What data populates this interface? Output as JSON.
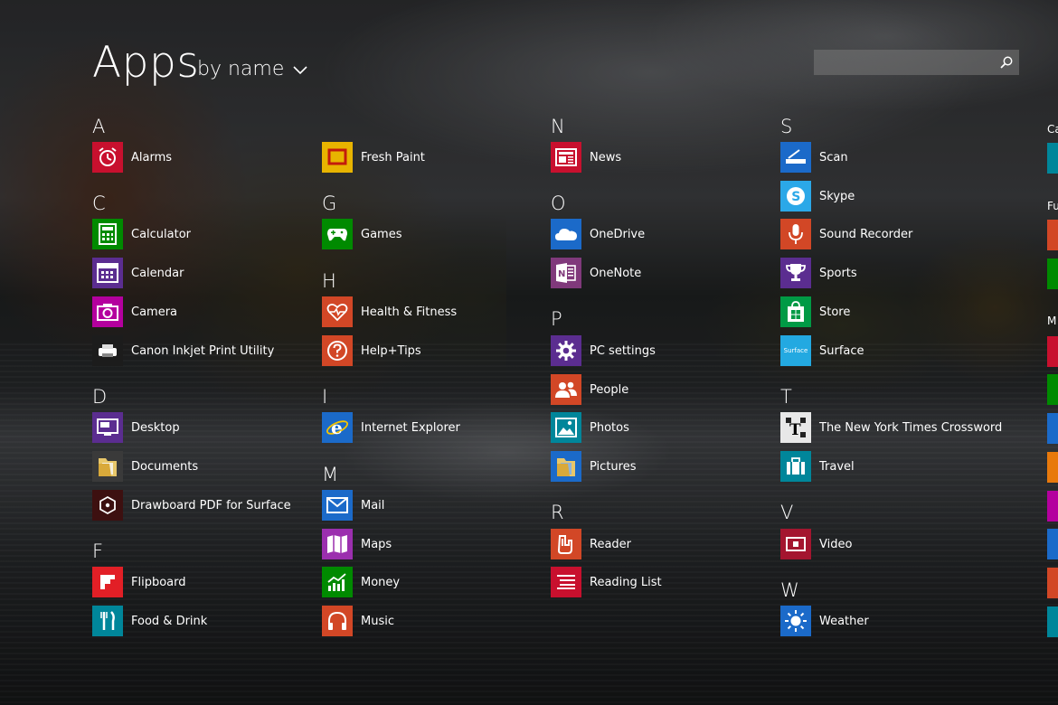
{
  "header": {
    "title": "Apps",
    "sort_label": "by name"
  },
  "search": {
    "placeholder": "",
    "value": ""
  },
  "groups": {
    "A": "A",
    "C": "C",
    "D": "D",
    "F": "F",
    "G": "G",
    "H": "H",
    "I": "I",
    "M": "M",
    "N": "N",
    "O": "O",
    "P": "P",
    "R": "R",
    "S": "S",
    "T": "T",
    "V": "V",
    "W": "W"
  },
  "apps": {
    "alarms": "Alarms",
    "calculator": "Calculator",
    "calendar": "Calendar",
    "camera": "Camera",
    "canon": "Canon Inkjet Print Utility",
    "desktop": "Desktop",
    "documents": "Documents",
    "drawboard": "Drawboard PDF for Surface",
    "flipboard": "Flipboard",
    "food": "Food & Drink",
    "freshpaint": "Fresh Paint",
    "games": "Games",
    "health": "Health & Fitness",
    "helptips": "Help+Tips",
    "ie": "Internet Explorer",
    "mail": "Mail",
    "maps": "Maps",
    "money": "Money",
    "music": "Music",
    "news": "News",
    "onedrive": "OneDrive",
    "onenote": "OneNote",
    "pcsettings": "PC settings",
    "people": "People",
    "photos": "Photos",
    "pictures": "Pictures",
    "reader": "Reader",
    "readinglist": "Reading List",
    "scan": "Scan",
    "skype": "Skype",
    "soundrecorder": "Sound Recorder",
    "sports": "Sports",
    "store": "Store",
    "surface": "Surface",
    "surface_tile_text": "Surface",
    "nytcrossword": "The New York Times Crossword",
    "travel": "Travel",
    "video": "Video",
    "weather": "Weather"
  },
  "edge": {
    "letters": [
      "Ca",
      "Fu",
      "M"
    ]
  },
  "colors": {
    "red": "#c8102e",
    "green": "#008a00",
    "purple": "#5b2d90",
    "magenta": "#b4009e",
    "dark": "#1c1c1c",
    "orange": "#d24726",
    "yellow": "#e8b400",
    "blue": "#1b6ac9",
    "teal": "#00869a",
    "skyblue": "#2ba8e8",
    "onenote": "#80397b",
    "store": "#009a45",
    "surface": "#23a9e1",
    "maroon": "#a4152f"
  }
}
